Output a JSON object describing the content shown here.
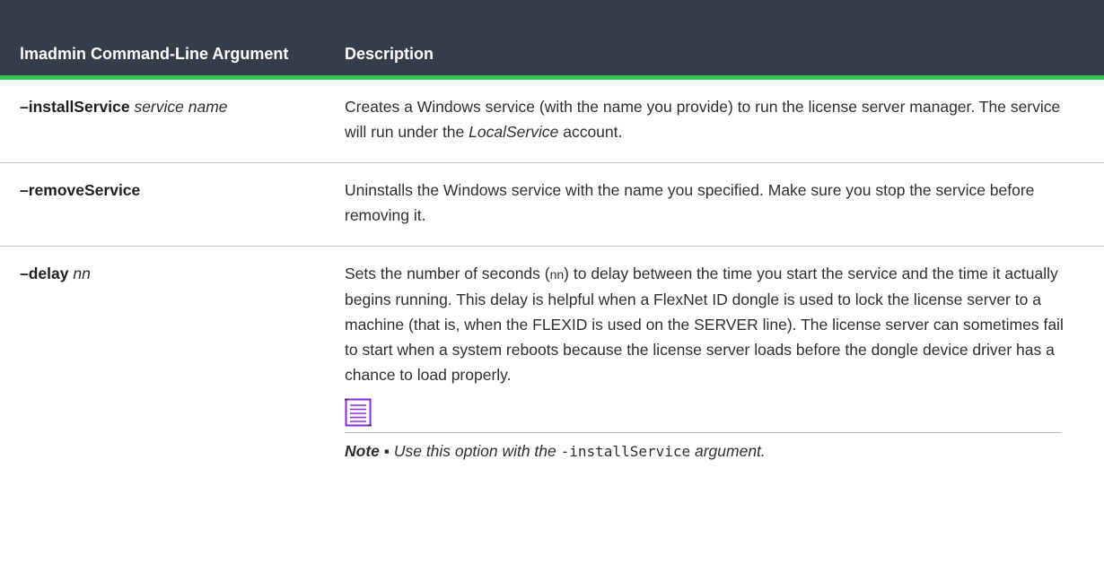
{
  "table": {
    "header": {
      "arg_col": "lmadmin Command-Line Argument",
      "desc_col": "Description"
    },
    "rows": [
      {
        "arg": "–installService",
        "param": "service name",
        "desc_part1": "Creates a Windows service (with the name you provide) to run the license server manager. The service will run under the ",
        "desc_em": "LocalService",
        "desc_part2": " account."
      },
      {
        "arg": "–removeService",
        "desc": "Uninstalls the Windows service with the name you specified. Make sure you stop the service before removing it."
      },
      {
        "arg": "–delay",
        "param": "nn",
        "desc_part1": "Sets the number of seconds (",
        "desc_small": "nn",
        "desc_part2": ") to delay between the time you start the service and the time it actually begins running. This delay is helpful when a FlexNet ID dongle is used to lock the license server to a machine (that is, when the FLEXID is used on the SERVER line). The license server can sometimes fail to start when a system reboots because the license server loads before the dongle device driver has a chance to load properly.",
        "note": {
          "icon": "note-icon",
          "label": "Note ▪",
          "text_before": " Use this option with the ",
          "code": "-installService",
          "text_after": " argument."
        }
      }
    ]
  },
  "colors": {
    "header_bg": "#343e48",
    "accent": "#31c653",
    "icon": "#8a2be2"
  }
}
